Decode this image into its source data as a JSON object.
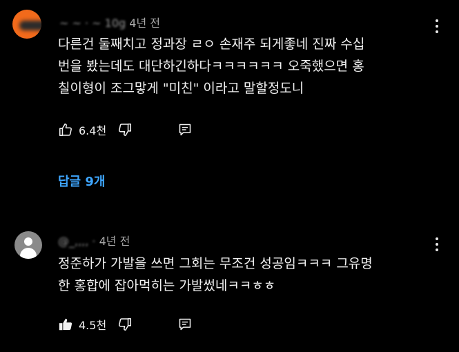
{
  "comments": [
    {
      "author": "~ ~ · ~ 10g",
      "time": "4년 전",
      "text": "다른건 둘째치고 정과장 ㄹㅇ 손재주 되게좋네 진짜 수십\n번을 봤는데도 대단하긴하다ㅋㅋㅋㅋㅋㅋ 오죽했으면 홍\n칠이형이 조그맣게 \"미친\" 이라고 말할정도니",
      "likes": "6.4천",
      "liked": false,
      "replies_label": "답글 9개"
    },
    {
      "author": "@_,,,, ·",
      "time": "4년 전",
      "text": "정준하가 가발을 쓰면 그회는 무조건 성공임ㅋㅋㅋ 그유명\n한 홍합에 잡아먹히는 가발썼네ㅋㅋㅎㅎ",
      "likes": "4.5천",
      "liked": true
    }
  ],
  "colors": {
    "background": "#000000",
    "text": "#f1f1f1",
    "meta": "#aaaaaa",
    "link": "#3ea6ff",
    "avatar_orange": "#f26a1b",
    "avatar_gray": "#8a8a8a"
  },
  "icons": [
    "thumb-up-outline-icon",
    "thumb-up-filled-icon",
    "thumb-down-outline-icon",
    "reply-icon",
    "more-vert-icon"
  ]
}
